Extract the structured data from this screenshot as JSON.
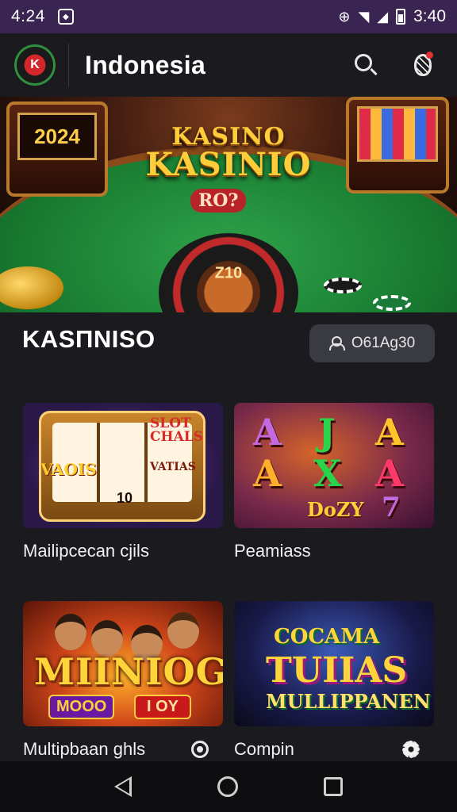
{
  "status_bar": {
    "time_left": "4:24",
    "time_right": "3:40"
  },
  "app_bar": {
    "title": "Indonesia",
    "logo_text": "K"
  },
  "hero": {
    "slot_left_text": "2024",
    "brand_line1": "KASINO",
    "brand_line2": "KASINIO",
    "felt_label": "RO?",
    "wheel_text": "Z10"
  },
  "section": {
    "title": "KASΠNISO",
    "pill_label": "O61Ag30"
  },
  "games": [
    {
      "label": "Mailipcecan cjils",
      "art": {
        "t1": "VAOIS",
        "t2": "SLOT CHALS",
        "t3": "VATIAS",
        "t4": "10"
      },
      "action_icon": null
    },
    {
      "label": "Peamiass",
      "art": {
        "letters": [
          "A",
          "J",
          "A",
          "A",
          "X",
          "A",
          "7"
        ],
        "bottom": "DoZY"
      },
      "action_icon": null
    },
    {
      "label": "Multipbaan ghls",
      "art": {
        "big": "MIINIOG",
        "b1": "MOOO",
        "b2": "I OY"
      },
      "action_icon": "radio-icon"
    },
    {
      "label": "Compin",
      "art": {
        "w1": "COCAMA",
        "w2": "TUIIAS",
        "w3": "MULLIPPANEN"
      },
      "action_icon": "gear-icon"
    }
  ],
  "colors": {
    "status_bar": "#3a2452",
    "background": "#1b1b1f",
    "pill": "#3a3a42"
  },
  "nav": {
    "icons": [
      "back-icon",
      "home-icon",
      "recents-icon"
    ]
  }
}
